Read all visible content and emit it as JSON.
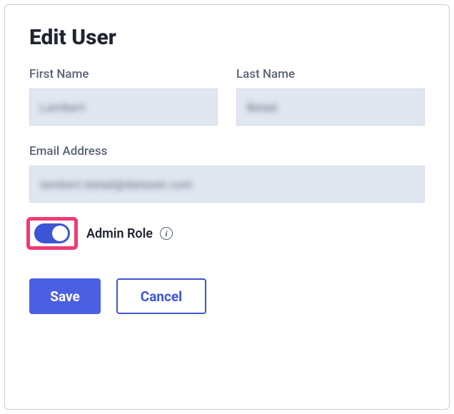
{
  "title": "Edit User",
  "fields": {
    "firstName": {
      "label": "First Name",
      "value": "Lambert"
    },
    "lastName": {
      "label": "Last Name",
      "value": "Belad"
    },
    "email": {
      "label": "Email Address",
      "value": "lambert.belad@dataset.com"
    }
  },
  "adminRole": {
    "label": "Admin Role",
    "enabled": true
  },
  "actions": {
    "save": "Save",
    "cancel": "Cancel"
  }
}
